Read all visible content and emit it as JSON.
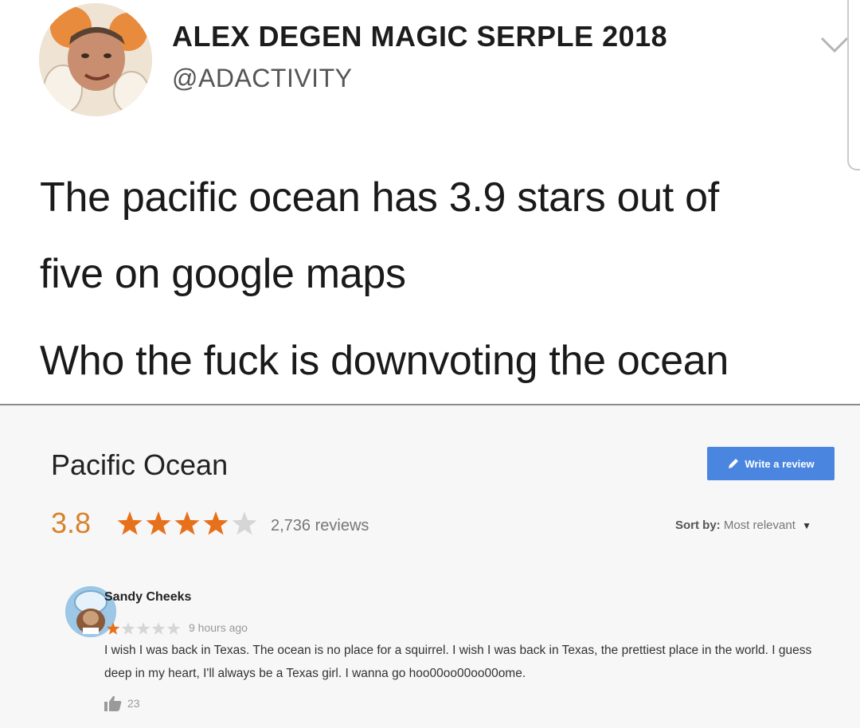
{
  "tweet": {
    "display_name": "ALEX DEGEN MAGIC SERPLE 2018",
    "handle": "@ADACTIVITY",
    "lines": [
      "The pacific ocean has 3.9 stars out of",
      "five on google maps",
      "Who the fuck is downvoting the ocean"
    ],
    "icons": {
      "avatar": "profile-photo",
      "menu": "chevron-down-icon"
    }
  },
  "place": {
    "title": "Pacific Ocean",
    "rating": "3.8",
    "rating_value": 3.8,
    "stars_total": 5,
    "review_count": "2,736 reviews",
    "write_review_label": "Write a review",
    "sort_label": "Sort by:",
    "sort_value": "Most relevant",
    "colors": {
      "star": "#e7711b",
      "star_empty": "#d6d6d6",
      "button": "#4a86e0"
    }
  },
  "review": {
    "author": "Sandy Cheeks",
    "stars": 1,
    "time": "9 hours ago",
    "text": "I wish I was back in Texas. The ocean is no place for a squirrel. I wish I was back in Texas, the prettiest place in the world. I guess deep in my heart, I'll always be a Texas girl. I wanna go hoo00oo00oo00ome.",
    "likes": "23"
  }
}
